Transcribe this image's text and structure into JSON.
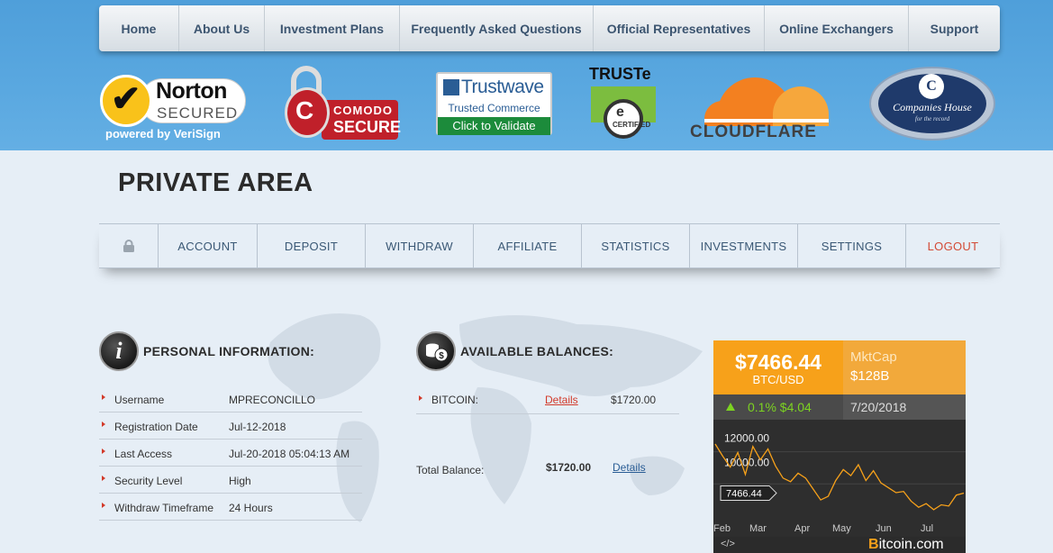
{
  "topnav": {
    "items": [
      {
        "label": "Home"
      },
      {
        "label": "About Us"
      },
      {
        "label": "Investment Plans"
      },
      {
        "label": "Frequently Asked Questions"
      },
      {
        "label": "Official Representatives"
      },
      {
        "label": "Online Exchangers"
      },
      {
        "label": "Support"
      }
    ]
  },
  "badges": {
    "norton": {
      "line1": "Norton",
      "line2": "SECURED",
      "line3": "powered by VeriSign"
    },
    "comodo": {
      "line1": "COMODO",
      "line2": "SECURE"
    },
    "trustwave": {
      "line1": "Trustwave",
      "line2": "Trusted Commerce",
      "line3": "Click to Validate"
    },
    "truste": {
      "line1": "TRUSTe",
      "line2": "CERTIFIED"
    },
    "cloudflare": {
      "line1": "CLOUDFLARE"
    },
    "companies_house": {
      "line1": "Companies House",
      "line2": "for the record"
    }
  },
  "page": {
    "title": "PRIVATE AREA"
  },
  "subnav": {
    "items": [
      {
        "label": "ACCOUNT"
      },
      {
        "label": "DEPOSIT"
      },
      {
        "label": "WITHDRAW"
      },
      {
        "label": "AFFILIATE"
      },
      {
        "label": "STATISTICS"
      },
      {
        "label": "INVESTMENTS"
      },
      {
        "label": "SETTINGS"
      },
      {
        "label": "LOGOUT"
      }
    ]
  },
  "personal": {
    "title": "PERSONAL INFORMATION:",
    "rows": [
      {
        "label": "Username",
        "value": "MPRECONCILLO"
      },
      {
        "label": "Registration Date",
        "value": "Jul-12-2018"
      },
      {
        "label": "Last Access",
        "value": "Jul-20-2018 05:04:13 AM"
      },
      {
        "label": "Security Level",
        "value": "High"
      },
      {
        "label": "Withdraw Timeframe",
        "value": "24 Hours"
      }
    ]
  },
  "balances": {
    "title": "AVAILABLE BALANCES:",
    "rows": [
      {
        "label": "BITCOIN:",
        "link": "Details",
        "amount": "$1720.00"
      }
    ],
    "total_label": "Total Balance:",
    "total_amount": "$1720.00",
    "total_link": "Details"
  },
  "btc_widget": {
    "price": "$7466.44",
    "pair": "BTC/USD",
    "mktcap_label": "MktCap",
    "mktcap_value": "$128B",
    "change": "0.1%  $4.04",
    "date": "7/20/2018",
    "code_icon": "</>",
    "brand_b": "B",
    "brand_rest": "itcoin.com",
    "colors": {
      "accent": "#f7a11a",
      "up": "#7cd321"
    }
  },
  "chart_data": {
    "type": "line",
    "series": [
      {
        "values": [
          11500,
          10500,
          9600,
          10800,
          9000,
          11300,
          10200,
          11100,
          9700,
          8700,
          8400,
          9100,
          8700,
          7800,
          6900,
          7200,
          8500,
          9400,
          8900,
          9800,
          8500,
          9300,
          8300,
          7900,
          7500,
          7600,
          6800,
          6300,
          6600,
          6100,
          6500,
          6400,
          7300,
          7466
        ]
      }
    ],
    "x_tick_labels": [
      "Feb",
      "Mar",
      "Apr",
      "May",
      "Jun",
      "Jul"
    ],
    "y_tick_labels": [
      "12000.00",
      "10000.00"
    ],
    "current_value_label": "7466.44",
    "ylim": [
      5500,
      13500
    ]
  }
}
